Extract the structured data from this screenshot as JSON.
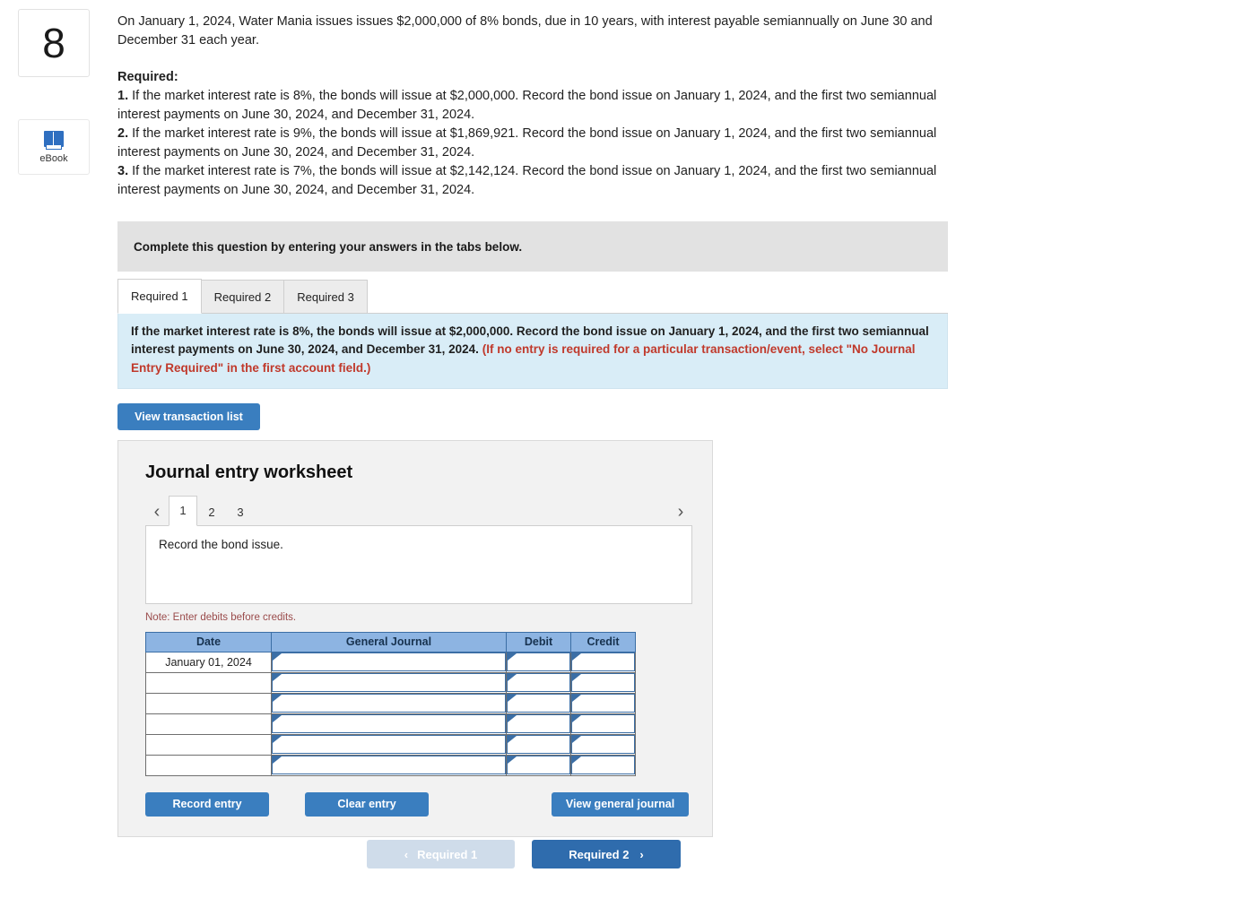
{
  "rail": {
    "question_number": "8",
    "ebook_label": "eBook"
  },
  "problem": {
    "intro": "On January 1, 2024, Water Mania issues issues $2,000,000 of 8% bonds, due in 10 years, with interest payable semiannually on June 30 and December 31 each year.",
    "required_title": "Required:",
    "items": [
      {
        "num": "1.",
        "text": "If the market interest rate is 8%, the bonds will issue at $2,000,000. Record the bond issue on January 1, 2024, and the first two semiannual interest payments on June 30, 2024, and December 31, 2024."
      },
      {
        "num": "2.",
        "text": "If the market interest rate is 9%, the bonds will issue at $1,869,921. Record the bond issue on January 1, 2024, and the first two semiannual interest payments on June 30, 2024, and December 31, 2024."
      },
      {
        "num": "3.",
        "text": "If the market interest rate is 7%, the bonds will issue at $2,142,124. Record the bond issue on January 1, 2024, and the first two semiannual interest payments on June 30, 2024, and December 31, 2024."
      }
    ]
  },
  "complete_bar": {
    "text": "Complete this question by entering your answers in the tabs below."
  },
  "tabs": [
    {
      "label": "Required 1",
      "active": true
    },
    {
      "label": "Required 2",
      "active": false
    },
    {
      "label": "Required 3",
      "active": false
    }
  ],
  "blue_note": {
    "main": "If the market interest rate is 8%, the bonds will issue at $2,000,000. Record the bond issue on January 1, 2024, and the first two semiannual interest payments on June 30, 2024, and December 31, 2024.",
    "red": "(If no entry is required for a particular transaction/event, select \"No Journal Entry Required\" in the first account field.)"
  },
  "buttons": {
    "view_transaction_list": "View transaction list",
    "record_entry": "Record entry",
    "clear_entry": "Clear entry",
    "view_general_journal": "View general journal"
  },
  "worksheet": {
    "title": "Journal entry worksheet",
    "pages": [
      "1",
      "2",
      "3"
    ],
    "active_page": "1",
    "prev_arrow": "‹",
    "next_arrow": "›",
    "prompt": "Record the bond issue.",
    "note": "Note: Enter debits before credits."
  },
  "journal_table": {
    "headers": [
      "Date",
      "General Journal",
      "Debit",
      "Credit"
    ],
    "rows": [
      {
        "date": "January 01, 2024",
        "general_journal": "",
        "debit": "",
        "credit": ""
      },
      {
        "date": "",
        "general_journal": "",
        "debit": "",
        "credit": ""
      },
      {
        "date": "",
        "general_journal": "",
        "debit": "",
        "credit": ""
      },
      {
        "date": "",
        "general_journal": "",
        "debit": "",
        "credit": ""
      },
      {
        "date": "",
        "general_journal": "",
        "debit": "",
        "credit": ""
      },
      {
        "date": "",
        "general_journal": "",
        "debit": "",
        "credit": ""
      }
    ]
  },
  "bottom_nav": {
    "prev_label": "Required 1",
    "prev_chevron": "‹",
    "next_label": "Required 2",
    "next_chevron": "›"
  },
  "colors": {
    "accent_blue": "#3a7ebf",
    "table_header_blue": "#8db4e2",
    "note_blue": "#d9edf7",
    "red_text": "#c0392b",
    "gray_bar": "#e2e2e2"
  }
}
